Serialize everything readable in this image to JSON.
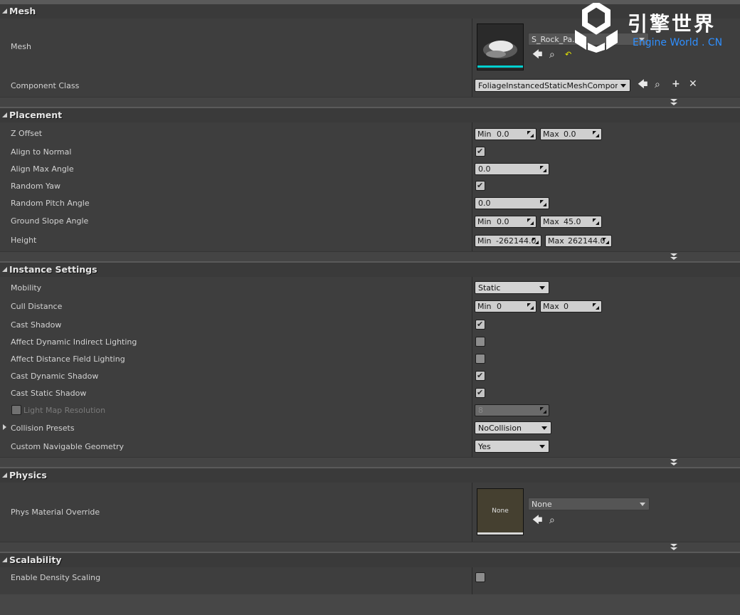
{
  "sections": {
    "mesh": {
      "title": "Mesh",
      "mesh_label": "Mesh",
      "mesh_asset": "S_Rock_Pa...",
      "component_class_label": "Component Class",
      "component_class_value": "FoliageInstancedStaticMeshComponent"
    },
    "placement": {
      "title": "Placement",
      "z_offset": {
        "label": "Z Offset",
        "min_prefix": "Min",
        "min": "0.0",
        "max_prefix": "Max",
        "max": "0.0"
      },
      "align_to_normal": {
        "label": "Align to Normal",
        "checked": true
      },
      "align_max_angle": {
        "label": "Align Max Angle",
        "value": "0.0"
      },
      "random_yaw": {
        "label": "Random Yaw",
        "checked": true
      },
      "random_pitch_angle": {
        "label": "Random Pitch Angle",
        "value": "0.0"
      },
      "ground_slope_angle": {
        "label": "Ground Slope Angle",
        "min_prefix": "Min",
        "min": "0.0",
        "max_prefix": "Max",
        "max": "45.0"
      },
      "height": {
        "label": "Height",
        "min_prefix": "Min",
        "min": "-262144.0",
        "max_prefix": "Max",
        "max": "262144.0"
      }
    },
    "instance": {
      "title": "Instance Settings",
      "mobility": {
        "label": "Mobility",
        "value": "Static"
      },
      "cull_distance": {
        "label": "Cull Distance",
        "min_prefix": "Min",
        "min": "0",
        "max_prefix": "Max",
        "max": "0"
      },
      "cast_shadow": {
        "label": "Cast Shadow",
        "checked": true
      },
      "affect_dynamic_indirect": {
        "label": "Affect Dynamic Indirect Lighting",
        "checked": false
      },
      "affect_distance_field": {
        "label": "Affect Distance Field Lighting",
        "checked": false
      },
      "cast_dynamic_shadow": {
        "label": "Cast Dynamic Shadow",
        "checked": true
      },
      "cast_static_shadow": {
        "label": "Cast Static Shadow",
        "checked": true
      },
      "light_map_resolution": {
        "label": "Light Map Resolution",
        "value": "8"
      },
      "collision_presets": {
        "label": "Collision Presets",
        "value": "NoCollision"
      },
      "custom_navigable_geometry": {
        "label": "Custom Navigable Geometry",
        "value": "Yes"
      }
    },
    "physics": {
      "title": "Physics",
      "phys_material_label": "Phys Material Override",
      "phys_material_thumb": "None",
      "phys_material_value": "None"
    },
    "scalability": {
      "title": "Scalability",
      "enable_density_scaling": {
        "label": "Enable Density Scaling",
        "checked": false
      }
    }
  },
  "watermark": {
    "cn": "引擎世界",
    "en": "Engine World . CN"
  },
  "icons": {
    "use": "arrow-left-icon",
    "browse": "search-icon",
    "reset": "reset-icon",
    "add": "plus-icon",
    "clear": "close-icon",
    "check": "checkmark-icon"
  }
}
